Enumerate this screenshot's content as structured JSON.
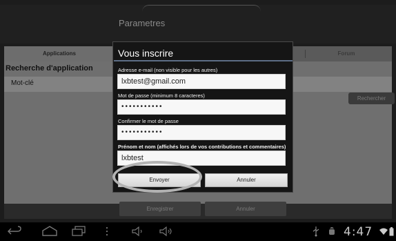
{
  "app": {
    "title": "Parametres",
    "tabs": [
      {
        "label": "Applications"
      },
      {
        "label": "Forum"
      }
    ],
    "search_heading": "Recherche d'application",
    "keyword_label": "Mot-clé",
    "search_button": "Rechercher",
    "save_button": "Enregistrer",
    "cancel_button": "Annuler",
    "footer_left": "",
    "footer_right": ""
  },
  "dialog": {
    "title": "Vous inscrire",
    "email_label": "Adresse e-mail (non visible pour les autres)",
    "email_value": "lxbtest@gmail.com",
    "password_label": "Mot de passe (minimum 8 caracteres)",
    "password_value": "•••••••••••",
    "confirm_label": "Confirmer le mot de passe",
    "confirm_value": "•••••••••••",
    "name_label": "Prénom et nom (affichés lors de vos contributions et commentaires)",
    "name_value": "lxbtest",
    "send_button": "Envoyer",
    "cancel_button": "Annuler"
  },
  "system_bar": {
    "time": "4:47",
    "icons": [
      "back-icon",
      "home-icon",
      "recent-apps-icon",
      "menu-icon",
      "volume-down-icon",
      "volume-up-icon",
      "usb-icon",
      "android-debug-icon",
      "wifi-icon",
      "battery-icon"
    ]
  },
  "colors": {
    "background": "#1c1c1c",
    "dialog_bg": "#151515",
    "divider": "#5d6e86",
    "system_bar": "#000000"
  }
}
